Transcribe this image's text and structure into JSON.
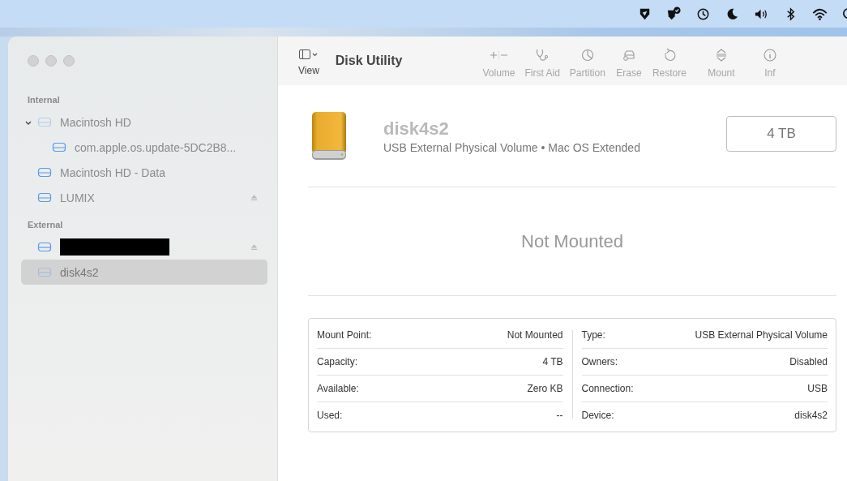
{
  "window": {
    "title": "Disk Utility"
  },
  "menu_bar": {
    "icons": [
      {
        "kind": "vpn"
      },
      {
        "kind": "shield"
      },
      {
        "kind": "time-machine"
      },
      {
        "kind": "focus"
      },
      {
        "kind": "volume"
      },
      {
        "kind": "bluetooth"
      },
      {
        "kind": "wifi"
      },
      {
        "kind": "search"
      }
    ]
  },
  "toolbar": {
    "view": {
      "label": "View"
    },
    "tools": [
      {
        "kind": "volume",
        "label": "Volume",
        "disabled": true
      },
      {
        "kind": "first-aid",
        "label": "First Aid",
        "disabled": true
      },
      {
        "kind": "partition",
        "label": "Partition",
        "disabled": true
      },
      {
        "kind": "erase",
        "label": "Erase",
        "disabled": true
      },
      {
        "kind": "restore",
        "label": "Restore",
        "disabled": true
      },
      {
        "kind": "mount",
        "label": "Mount",
        "disabled": true
      },
      {
        "kind": "info",
        "label": "Inf",
        "disabled": true
      }
    ]
  },
  "sidebar": {
    "sections": [
      {
        "title": "Internal",
        "items": [
          {
            "label": "Macintosh HD",
            "selected": false,
            "dimmed": true,
            "ejectable": false,
            "expanded": true,
            "children": [
              {
                "label": "com.apple.os.update-5DC2B8...",
                "selected": false,
                "dimmed": false,
                "ejectable": false
              }
            ]
          },
          {
            "label": "Macintosh HD - Data",
            "selected": false,
            "dimmed": false,
            "ejectable": false
          },
          {
            "label": "LUMIX",
            "selected": false,
            "dimmed": false,
            "ejectable": true
          }
        ]
      },
      {
        "title": "External",
        "items": [
          {
            "redacted": true,
            "selected": false,
            "dimmed": false,
            "ejectable": true
          },
          {
            "label": "disk4s2",
            "selected": true,
            "dimmed": true,
            "ejectable": false
          }
        ]
      }
    ]
  },
  "volume": {
    "name": "disk4s2",
    "description": "USB External Physical Volume • Mac OS Extended",
    "size": "4 TB",
    "status": "Not Mounted"
  },
  "info": {
    "left": [
      {
        "label": "Mount Point:",
        "value": "Not Mounted"
      },
      {
        "label": "Capacity:",
        "value": "4 TB"
      },
      {
        "label": "Available:",
        "value": "Zero KB"
      },
      {
        "label": "Used:",
        "value": "--"
      }
    ],
    "right": [
      {
        "label": "Type:",
        "value": "USB External Physical Volume"
      },
      {
        "label": "Owners:",
        "value": "Disabled"
      },
      {
        "label": "Connection:",
        "value": "USB"
      },
      {
        "label": "Device:",
        "value": "disk4s2"
      }
    ]
  }
}
